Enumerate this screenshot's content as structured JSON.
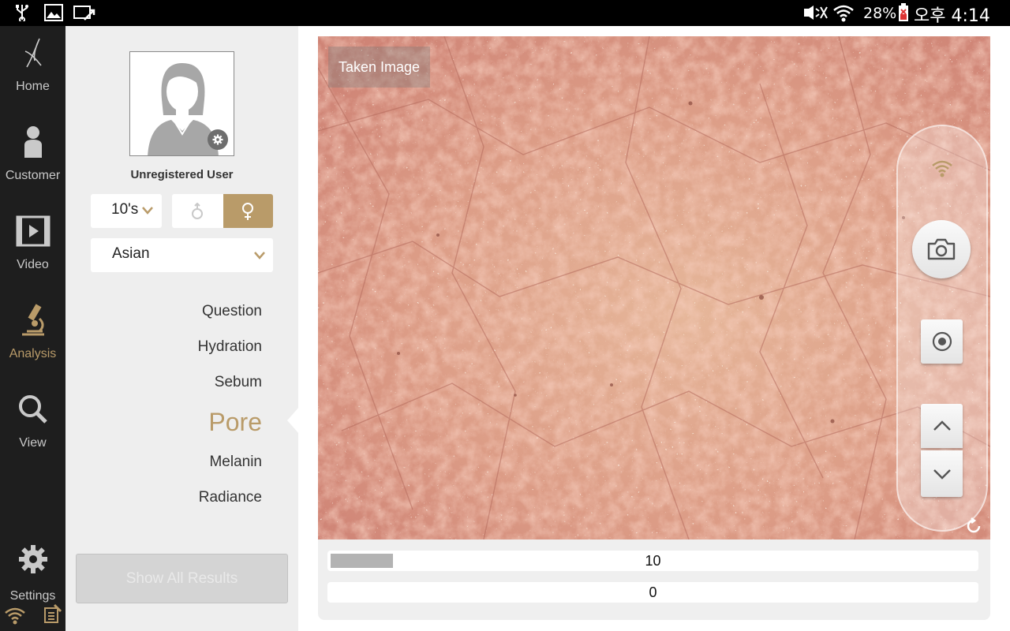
{
  "status_bar": {
    "battery": "28%",
    "time": "오후 4:14",
    "icons_left": [
      "usb-icon",
      "image-icon",
      "screen-share-icon"
    ],
    "icons_right": [
      "mute-icon",
      "wifi-icon",
      "battery-icon"
    ]
  },
  "nav": {
    "items": [
      {
        "label": "Home",
        "icon": "home-logo-icon"
      },
      {
        "label": "Customer",
        "icon": "person-icon"
      },
      {
        "label": "Video",
        "icon": "video-icon"
      },
      {
        "label": "Analysis",
        "icon": "microscope-icon",
        "active": true
      },
      {
        "label": "View",
        "icon": "search-icon"
      },
      {
        "label": "Settings",
        "icon": "gear-icon"
      }
    ],
    "active_color": "#b99b69"
  },
  "profile": {
    "name": "Unregistered User",
    "age_group": "10's",
    "gender_selected": "female",
    "ethnicity": "Asian"
  },
  "analysis_menu": {
    "items": [
      "Question",
      "Hydration",
      "Sebum",
      "Pore",
      "Melanin",
      "Radiance"
    ],
    "active": "Pore"
  },
  "show_all_button": "Show All Results",
  "image": {
    "label": "Taken Image"
  },
  "meters": [
    {
      "value": "10",
      "fill_fraction": 0.1
    },
    {
      "value": "0",
      "fill_fraction": 0
    }
  ],
  "colors": {
    "accent": "#b99b69",
    "sidebar_bg": "#1e1e1e",
    "panel_bg": "#eeeeee"
  }
}
